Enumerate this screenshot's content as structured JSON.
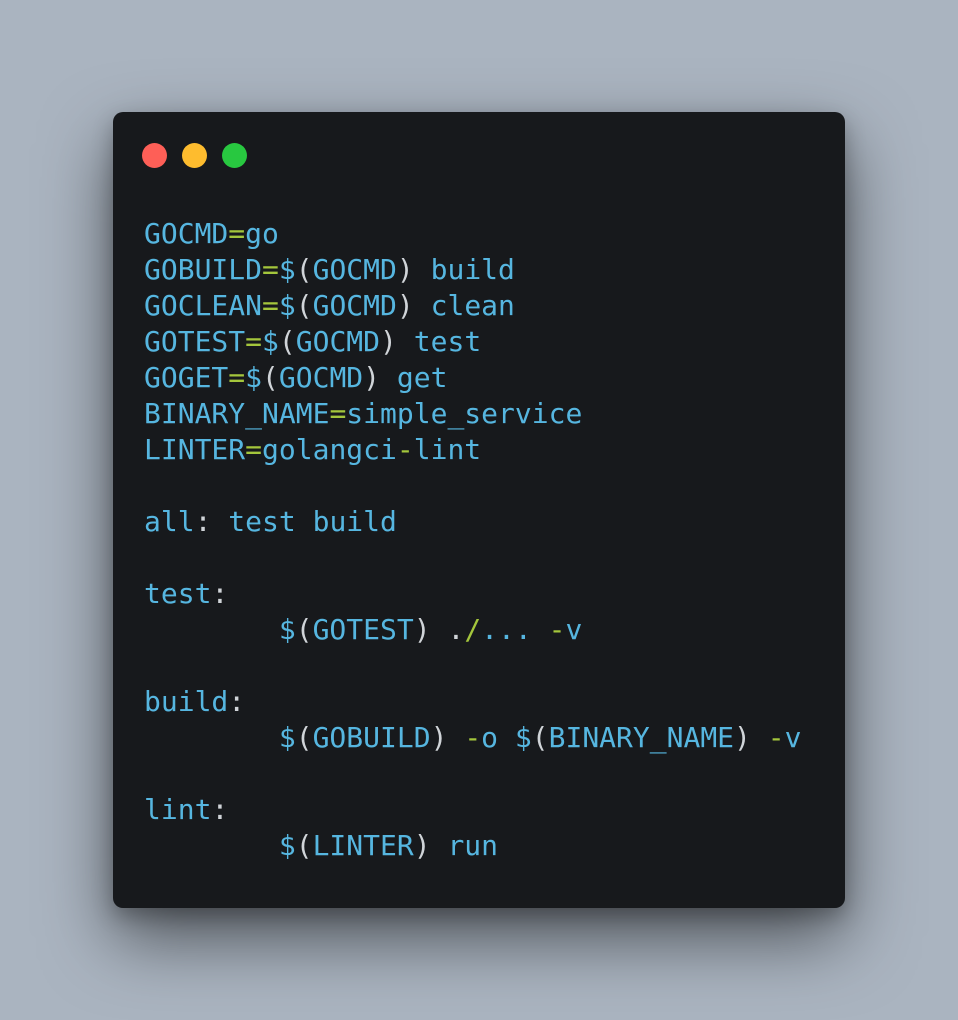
{
  "colors": {
    "background": "#aab4c0",
    "window": "#17191c",
    "identifier": "#56b6e0",
    "operator": "#a4c63c",
    "punctuation": "#d0d4d8",
    "dot_close": "#fe5f57",
    "dot_minimize": "#febc2e",
    "dot_maximize": "#28c840"
  },
  "window_controls": [
    {
      "name": "close",
      "color": "#fe5f57"
    },
    {
      "name": "minimize",
      "color": "#febc2e"
    },
    {
      "name": "maximize",
      "color": "#28c840"
    }
  ],
  "code_lines": [
    [
      {
        "t": "GOCMD",
        "c": "ident"
      },
      {
        "t": "=",
        "c": "op"
      },
      {
        "t": "go",
        "c": "ident"
      }
    ],
    [
      {
        "t": "GOBUILD",
        "c": "ident"
      },
      {
        "t": "=",
        "c": "op"
      },
      {
        "t": "$",
        "c": "ident"
      },
      {
        "t": "(",
        "c": "punc"
      },
      {
        "t": "GOCMD",
        "c": "ident"
      },
      {
        "t": ") ",
        "c": "punc"
      },
      {
        "t": "build",
        "c": "ident"
      }
    ],
    [
      {
        "t": "GOCLEAN",
        "c": "ident"
      },
      {
        "t": "=",
        "c": "op"
      },
      {
        "t": "$",
        "c": "ident"
      },
      {
        "t": "(",
        "c": "punc"
      },
      {
        "t": "GOCMD",
        "c": "ident"
      },
      {
        "t": ") ",
        "c": "punc"
      },
      {
        "t": "clean",
        "c": "ident"
      }
    ],
    [
      {
        "t": "GOTEST",
        "c": "ident"
      },
      {
        "t": "=",
        "c": "op"
      },
      {
        "t": "$",
        "c": "ident"
      },
      {
        "t": "(",
        "c": "punc"
      },
      {
        "t": "GOCMD",
        "c": "ident"
      },
      {
        "t": ") ",
        "c": "punc"
      },
      {
        "t": "test",
        "c": "ident"
      }
    ],
    [
      {
        "t": "GOGET",
        "c": "ident"
      },
      {
        "t": "=",
        "c": "op"
      },
      {
        "t": "$",
        "c": "ident"
      },
      {
        "t": "(",
        "c": "punc"
      },
      {
        "t": "GOCMD",
        "c": "ident"
      },
      {
        "t": ") ",
        "c": "punc"
      },
      {
        "t": "get",
        "c": "ident"
      }
    ],
    [
      {
        "t": "BINARY_NAME",
        "c": "ident"
      },
      {
        "t": "=",
        "c": "op"
      },
      {
        "t": "simple_service",
        "c": "ident"
      }
    ],
    [
      {
        "t": "LINTER",
        "c": "ident"
      },
      {
        "t": "=",
        "c": "op"
      },
      {
        "t": "golangci",
        "c": "ident"
      },
      {
        "t": "-",
        "c": "op"
      },
      {
        "t": "lint",
        "c": "ident"
      }
    ],
    [],
    [
      {
        "t": "all",
        "c": "ident"
      },
      {
        "t": ": ",
        "c": "punc"
      },
      {
        "t": "test build",
        "c": "ident"
      }
    ],
    [],
    [
      {
        "t": "test",
        "c": "ident"
      },
      {
        "t": ":",
        "c": "punc"
      }
    ],
    [
      {
        "t": "        ",
        "c": "punc"
      },
      {
        "t": "$",
        "c": "ident"
      },
      {
        "t": "(",
        "c": "punc"
      },
      {
        "t": "GOTEST",
        "c": "ident"
      },
      {
        "t": ") .",
        "c": "punc"
      },
      {
        "t": "/",
        "c": "op"
      },
      {
        "t": "... ",
        "c": "ident"
      },
      {
        "t": "-",
        "c": "op"
      },
      {
        "t": "v",
        "c": "ident"
      }
    ],
    [],
    [
      {
        "t": "build",
        "c": "ident"
      },
      {
        "t": ":",
        "c": "punc"
      }
    ],
    [
      {
        "t": "        ",
        "c": "punc"
      },
      {
        "t": "$",
        "c": "ident"
      },
      {
        "t": "(",
        "c": "punc"
      },
      {
        "t": "GOBUILD",
        "c": "ident"
      },
      {
        "t": ") ",
        "c": "punc"
      },
      {
        "t": "-",
        "c": "op"
      },
      {
        "t": "o ",
        "c": "ident"
      },
      {
        "t": "$",
        "c": "ident"
      },
      {
        "t": "(",
        "c": "punc"
      },
      {
        "t": "BINARY_NAME",
        "c": "ident"
      },
      {
        "t": ") ",
        "c": "punc"
      },
      {
        "t": "-",
        "c": "op"
      },
      {
        "t": "v",
        "c": "ident"
      }
    ],
    [],
    [
      {
        "t": "lint",
        "c": "ident"
      },
      {
        "t": ":",
        "c": "punc"
      }
    ],
    [
      {
        "t": "        ",
        "c": "punc"
      },
      {
        "t": "$",
        "c": "ident"
      },
      {
        "t": "(",
        "c": "punc"
      },
      {
        "t": "LINTER",
        "c": "ident"
      },
      {
        "t": ") ",
        "c": "punc"
      },
      {
        "t": "run",
        "c": "ident"
      }
    ]
  ]
}
